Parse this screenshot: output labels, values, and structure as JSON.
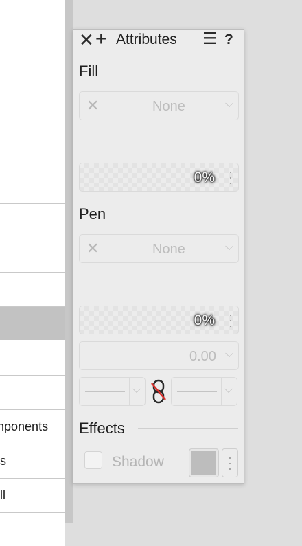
{
  "document_list": {
    "rows": [
      {
        "label": ""
      },
      {
        "label": ""
      },
      {
        "label": ""
      },
      {
        "label": "",
        "selected": true
      },
      {
        "label": ""
      },
      {
        "label": ""
      },
      {
        "label": "nponents"
      },
      {
        "label": "s"
      },
      {
        "label": "ll"
      },
      {
        "label": ""
      }
    ]
  },
  "panel": {
    "close_glyph": "✕",
    "add_glyph": "+",
    "title": "Attributes",
    "menu_glyph": "☰",
    "help_glyph": "?",
    "fill": {
      "section_title": "Fill",
      "type_value": "None",
      "opacity": "0%"
    },
    "pen": {
      "section_title": "Pen",
      "type_value": "None",
      "opacity": "0%",
      "width": "0.00"
    },
    "effects": {
      "section_title": "Effects",
      "shadow_label": "Shadow",
      "shadow_checked": false
    }
  },
  "icons": {
    "close": "close-icon",
    "add": "plus-icon",
    "menu": "hamburger-menu-icon",
    "help": "help-icon",
    "none_fill": "cross-icon",
    "chevron": "chevron-down-icon",
    "more": "more-dots-icon",
    "link": "link-broken-icon"
  },
  "colors": {
    "panel_bg": "#ececec",
    "selected_row": "#c2c2c2",
    "disabled_text": "#bdbdbd",
    "link_slash": "#d9302c"
  }
}
